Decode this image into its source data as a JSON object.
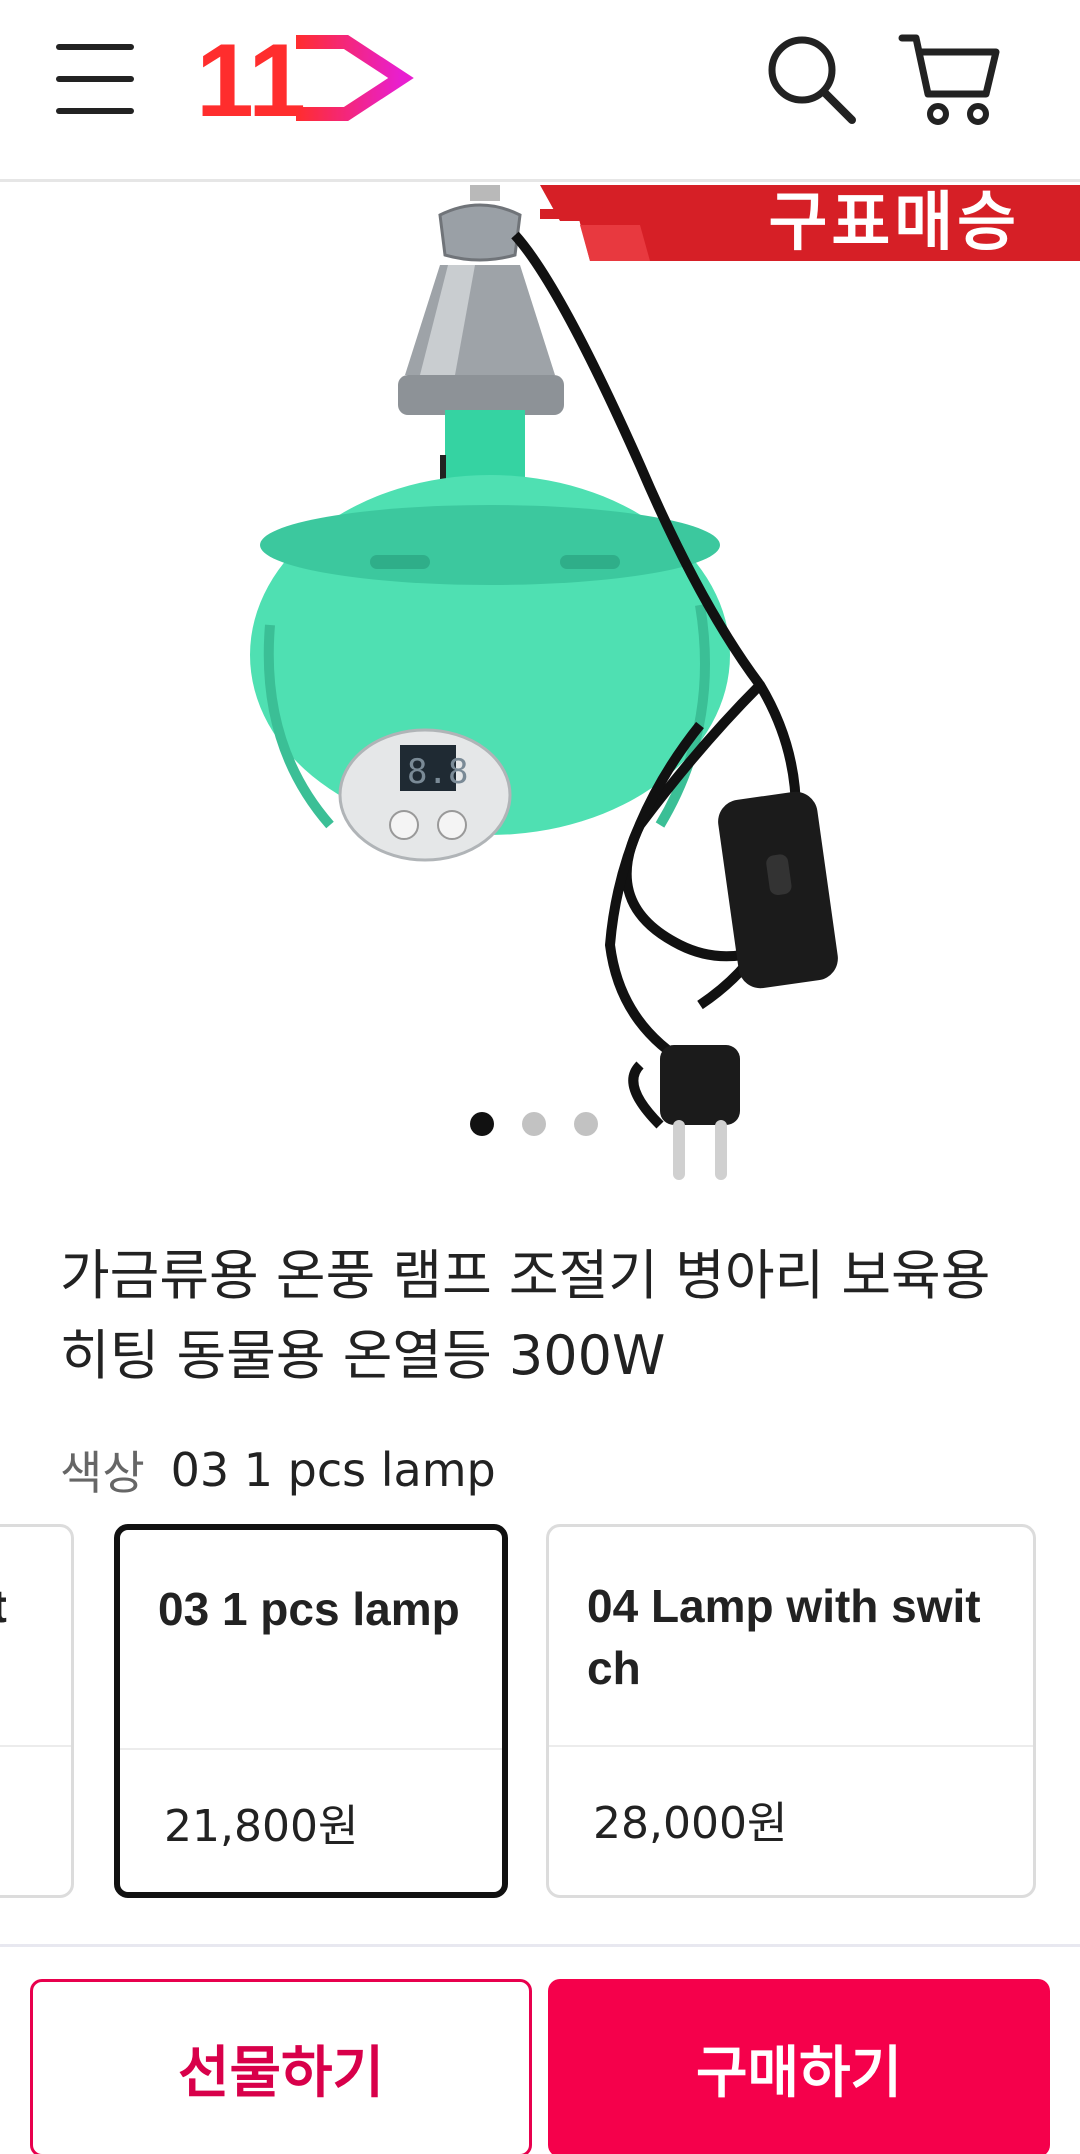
{
  "header": {
    "logo_text": "11",
    "icons": {
      "menu": "menu-icon",
      "search": "search-icon",
      "cart": "cart-icon"
    }
  },
  "hero": {
    "banner_text": "구표매승",
    "carousel": {
      "total": 3,
      "active": 1
    }
  },
  "product": {
    "title_line1": "가금류용 온풍 램프 조절기 병아리 보육용",
    "title_line2": "히팅 동물용 온열등 300W"
  },
  "option": {
    "label": "색상",
    "selected_value": "03 1 pcs lamp",
    "cards": [
      {
        "name": "wit",
        "price": ""
      },
      {
        "name": "03 1 pcs lamp",
        "price": "21,800원"
      },
      {
        "name": "04 Lamp with swit ch",
        "price": "28,000원"
      }
    ]
  },
  "actions": {
    "gift_label": "선물하기",
    "buy_label": "구매하기"
  },
  "colors": {
    "brand_red": "#f5004b",
    "logo_gradient_start": "#ff2d2d",
    "logo_gradient_end": "#e81fd0"
  }
}
